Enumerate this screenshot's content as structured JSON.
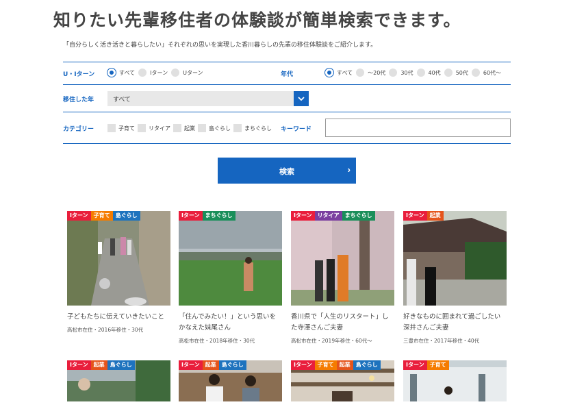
{
  "header": {
    "title": "知りたい先輩移住者の体験談が簡単検索できます。",
    "subtitle": "「自分らしく活き活きと暮らしたい」それぞれの思いを実現した香川暮らしの先輩の移住体験談をご紹介します。"
  },
  "filters": {
    "turn": {
      "label": "U・Iターン",
      "options": [
        "すべて",
        "Iターン",
        "Uターン"
      ],
      "selected": "すべて"
    },
    "age": {
      "label": "年代",
      "options": [
        "すべて",
        "〜20代",
        "30代",
        "40代",
        "50代",
        "60代〜"
      ],
      "selected": "すべて"
    },
    "year": {
      "label": "移住した年",
      "value": "すべて"
    },
    "category": {
      "label": "カテゴリー",
      "options": [
        "子育て",
        "リタイア",
        "起業",
        "島ぐらし",
        "まちぐらし"
      ]
    },
    "keyword": {
      "label": "キーワード",
      "value": ""
    },
    "search_label": "検索"
  },
  "tag_colors": {
    "Iターン": "#e91e3c",
    "子育て": "#f57c00",
    "島ぐらし": "#1e73be",
    "まちぐらし": "#1a8f5a",
    "リタイア": "#7b3fa0",
    "起業": "#e5541b"
  },
  "cards": [
    {
      "tags": [
        "Iターン",
        "子育て",
        "島ぐらし"
      ],
      "title": "子どもたちに伝えていきたいこと",
      "meta": "高松市在住・2016年移住・30代"
    },
    {
      "tags": [
        "Iターン",
        "まちぐらし"
      ],
      "title": "「住んでみたい！」という思いをかなえた妹尾さん",
      "meta": "高松市在住・2018年移住・30代"
    },
    {
      "tags": [
        "Iターン",
        "リタイア",
        "まちぐらし"
      ],
      "title": "香川県で「人生のリスタート」した寺澤さんご夫妻",
      "meta": "高松市在住・2019年移住・60代〜"
    },
    {
      "tags": [
        "Iターン",
        "起業"
      ],
      "title": "好きなものに囲まれて過ごしたい深井さんご夫妻",
      "meta": "三豊市在住・2017年移住・40代"
    }
  ],
  "cards_row2": [
    {
      "tags": [
        "Iターン",
        "起業",
        "島ぐらし"
      ]
    },
    {
      "tags": [
        "Iターン",
        "起業",
        "島ぐらし"
      ]
    },
    {
      "tags": [
        "Iターン",
        "子育て",
        "起業",
        "島ぐらし"
      ]
    },
    {
      "tags": [
        "Iターン",
        "子育て"
      ]
    }
  ]
}
